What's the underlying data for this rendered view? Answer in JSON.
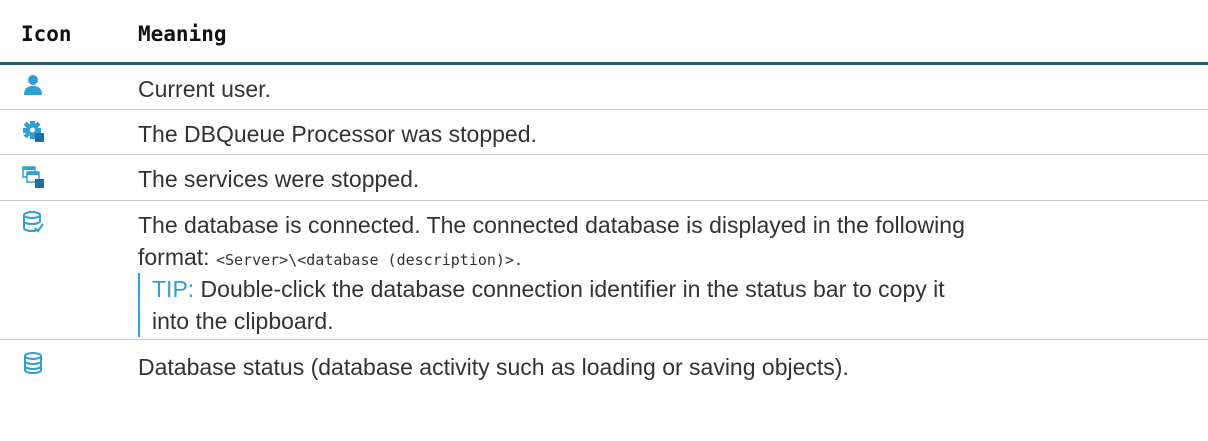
{
  "header": {
    "icon_col": "Icon",
    "meaning_col": "Meaning"
  },
  "rows": [
    {
      "icon": "user-icon",
      "meaning": "Current user."
    },
    {
      "icon": "gear-stopped-icon",
      "meaning": "The DBQueue Processor was stopped."
    },
    {
      "icon": "services-stopped-icon",
      "meaning": "The services were stopped."
    },
    {
      "icon": "database-connected-icon",
      "meaning_line1": "The database is connected. The connected database is displayed in the following",
      "meaning_line2_prefix": "format: ",
      "meaning_line2_code": "<Server>\\<database (description)>.",
      "tip_label": "TIP:",
      "tip_text_line1": " Double-click the database connection identifier in the status bar to copy it",
      "tip_text_line2": "into the clipboard."
    },
    {
      "icon": "database-status-icon",
      "meaning": "Database status (database activity such as loading or saving objects)."
    }
  ],
  "colors": {
    "icon_blue": "#2e9fd8",
    "header_rule": "#2a5b74",
    "tip_accent": "#2e9fd8"
  }
}
